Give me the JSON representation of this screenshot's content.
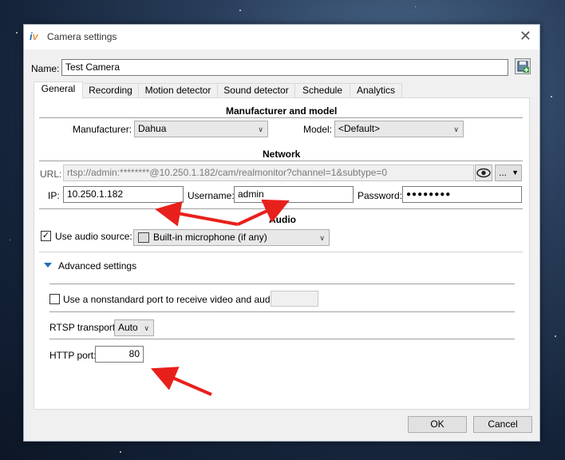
{
  "window": {
    "title": "Camera settings"
  },
  "name_row": {
    "label": "Name:",
    "value": "Test Camera"
  },
  "tabs": [
    {
      "label": "General",
      "active": true
    },
    {
      "label": "Recording",
      "active": false
    },
    {
      "label": "Motion detector",
      "active": false
    },
    {
      "label": "Sound detector",
      "active": false
    },
    {
      "label": "Schedule",
      "active": false
    },
    {
      "label": "Analytics",
      "active": false
    }
  ],
  "manufacturer_section": {
    "title": "Manufacturer and model",
    "manufacturer_label": "Manufacturer:",
    "manufacturer_value": "Dahua",
    "model_label": "Model:",
    "model_value": "<Default>"
  },
  "network": {
    "title": "Network",
    "url_label": "URL:",
    "url_value": "rtsp://admin:********@10.250.1.182/cam/realmonitor?channel=1&subtype=0",
    "more_button": "...",
    "ip_label": "IP:",
    "ip_value": "10.250.1.182",
    "username_label": "Username:",
    "username_value": "admin",
    "password_label": "Password:",
    "password_value": "●●●●●●●●"
  },
  "audio": {
    "title": "Audio",
    "use_audio_label": "Use audio source:",
    "use_audio_checked": true,
    "source_value": "Built-in microphone (if any)"
  },
  "advanced": {
    "toggle_label": "Advanced settings",
    "nonstandard_port_label": "Use a nonstandard port to receive video and audio:",
    "nonstandard_port_checked": false,
    "nonstandard_port_value": "",
    "rtsp_label": "RTSP transport:",
    "rtsp_value": "Auto",
    "http_label": "HTTP port:",
    "http_value": "80"
  },
  "footer": {
    "ok_label": "OK",
    "cancel_label": "Cancel"
  },
  "colors": {
    "arrow": "#e8201c",
    "accent": "#1f6fb8"
  }
}
